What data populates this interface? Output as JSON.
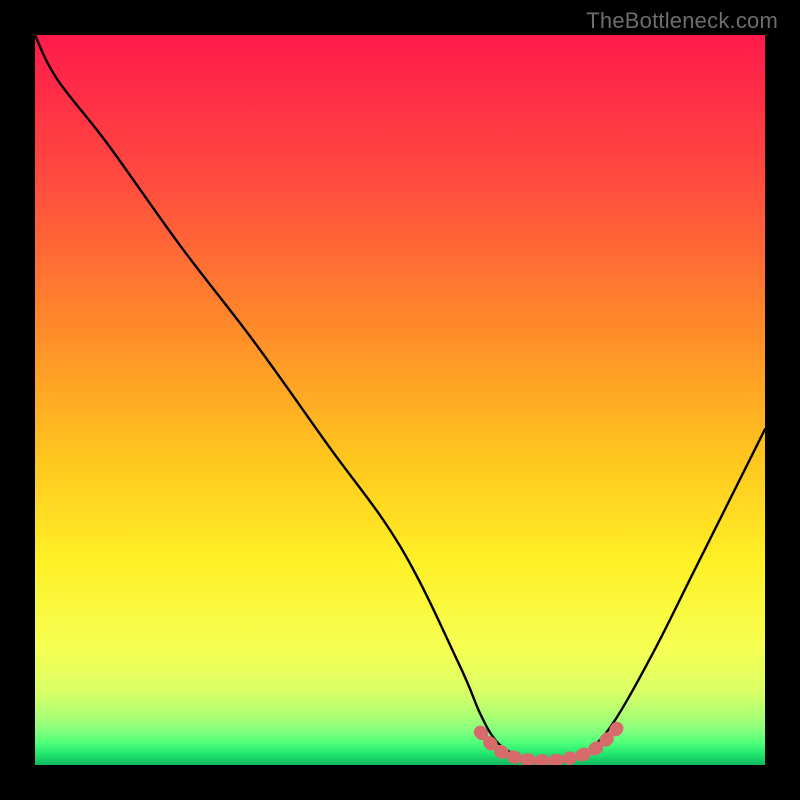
{
  "watermark": "TheBottleneck.com",
  "chart_data": {
    "type": "line",
    "title": "",
    "xlabel": "",
    "ylabel": "",
    "xlim": [
      0,
      100
    ],
    "ylim": [
      0,
      100
    ],
    "series": [
      {
        "name": "curve",
        "color": "#000000",
        "x": [
          0,
          3,
          10,
          20,
          30,
          40,
          50,
          58,
          61,
          63,
          65,
          67,
          69,
          71,
          73,
          75,
          77,
          80,
          85,
          90,
          95,
          100
        ],
        "y": [
          100,
          94,
          85,
          71,
          58,
          44,
          30,
          14,
          7,
          3.5,
          1.8,
          0.9,
          0.5,
          0.5,
          0.8,
          1.5,
          3,
          7,
          16,
          26,
          36,
          46
        ]
      },
      {
        "name": "flat-segment",
        "color": "#d76a6a",
        "x": [
          61,
          63,
          65,
          67,
          69,
          71,
          73,
          75,
          77,
          79,
          80.5
        ],
        "y": [
          4.5,
          2.4,
          1.3,
          0.8,
          0.6,
          0.6,
          0.9,
          1.4,
          2.4,
          4.2,
          6
        ]
      }
    ],
    "background_gradient": {
      "stops": [
        {
          "offset": 0.0,
          "color": "#ff1a4b"
        },
        {
          "offset": 0.2,
          "color": "#ff4b3f"
        },
        {
          "offset": 0.4,
          "color": "#ff8a2a"
        },
        {
          "offset": 0.58,
          "color": "#ffc61e"
        },
        {
          "offset": 0.72,
          "color": "#fff026"
        },
        {
          "offset": 0.84,
          "color": "#f6ff52"
        },
        {
          "offset": 0.9,
          "color": "#d9ff66"
        },
        {
          "offset": 0.935,
          "color": "#a8ff74"
        },
        {
          "offset": 0.955,
          "color": "#7dff7d"
        },
        {
          "offset": 0.97,
          "color": "#4eff7a"
        },
        {
          "offset": 0.985,
          "color": "#22e56e"
        },
        {
          "offset": 1.0,
          "color": "#0fb85f"
        }
      ]
    }
  }
}
